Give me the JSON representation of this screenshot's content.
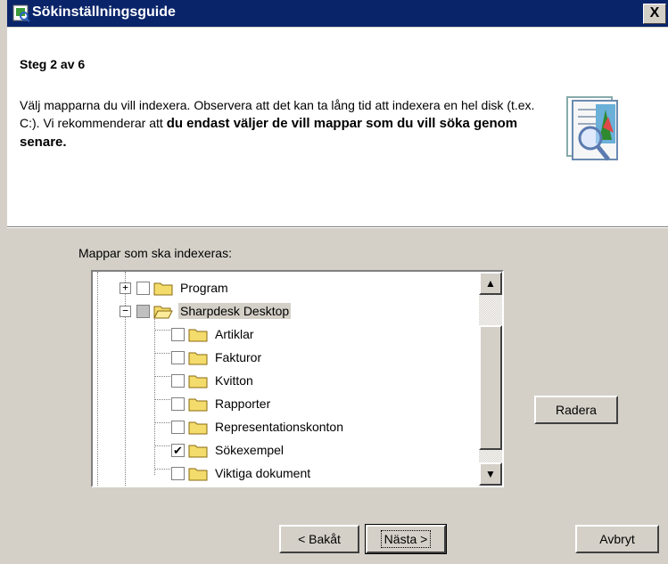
{
  "window": {
    "title": "Sökinställningsguide",
    "close_glyph": "X"
  },
  "header": {
    "step": "Steg 2 av 6",
    "description_plain": "Välj mapparna du vill indexera. Observera att det kan ta lång tid att indexera en hel disk (t.ex. C:). Vi rekommenderar att ",
    "description_bold": "du endast väljer de vill mappar som du vill söka genom senare."
  },
  "folders": {
    "label": "Mappar som ska indexeras:",
    "items": [
      {
        "name": "Program",
        "level": 0,
        "expander": "+",
        "checked": false
      },
      {
        "name": "Sharpdesk Desktop",
        "level": 0,
        "expander": "−",
        "checked": "partial",
        "selected": true
      },
      {
        "name": "Artiklar",
        "level": 1,
        "checked": false
      },
      {
        "name": "Fakturor",
        "level": 1,
        "checked": false
      },
      {
        "name": "Kvitton",
        "level": 1,
        "checked": false
      },
      {
        "name": "Rapporter",
        "level": 1,
        "checked": false
      },
      {
        "name": "Representationskonton",
        "level": 1,
        "checked": false
      },
      {
        "name": "Sökexempel",
        "level": 1,
        "checked": true
      },
      {
        "name": "Viktiga dokument",
        "level": 1,
        "checked": false
      }
    ]
  },
  "buttons": {
    "remove": "Radera",
    "back": "< Bakåt",
    "next": "Nästa >",
    "cancel": "Avbryt"
  },
  "icons": {
    "scroll_up": "▲",
    "scroll_down": "▼",
    "check": "✔"
  }
}
